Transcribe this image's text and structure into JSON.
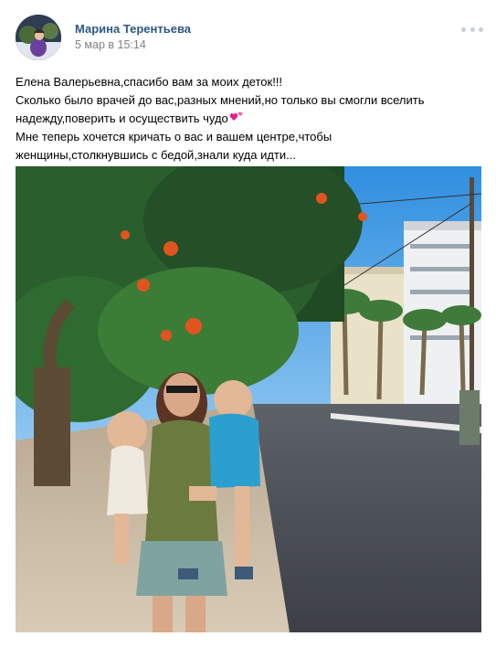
{
  "post": {
    "author": "Марина Терентьева",
    "date": "5 мар в 15:14",
    "text_lines": [
      "Елена Валерьевна,спасибо вам за моих деток!!!",
      "Сколько было врачей до вас,разных мнений,но только вы смогли вселить",
      "надежду,поверить и осуществить чудо",
      "Мне теперь хочется кричать о вас и вашем центре,чтобы",
      "женщины,столкнувшись с бедой,знали куда идти..."
    ],
    "emoji": "heart-emoji",
    "menu_icon": "more-options-icon"
  },
  "colors": {
    "author_link": "#2a5885",
    "date": "#828282",
    "menu_dots": "#c5cfdb",
    "heart": "#e91e8c"
  }
}
